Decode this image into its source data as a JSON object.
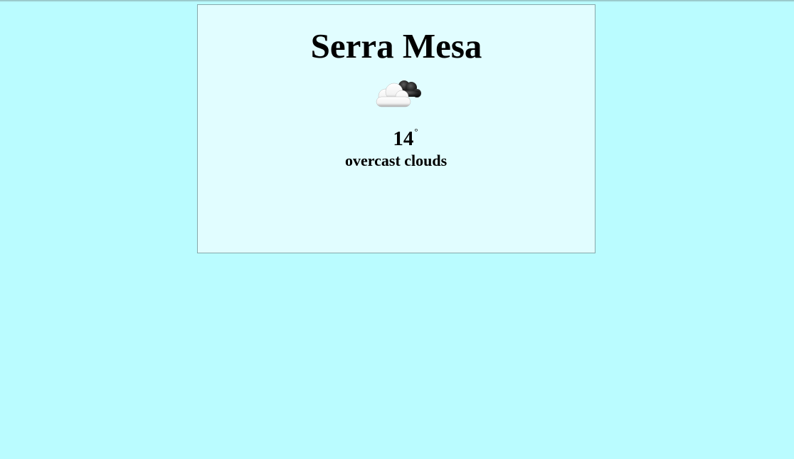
{
  "weather": {
    "city": "Serra Mesa",
    "temperature": "14",
    "degree_symbol": "°",
    "description": "overcast clouds",
    "icon": "overcast-clouds-icon"
  },
  "colors": {
    "page_background": "#bafcff",
    "card_background": "#e1fdff",
    "card_border": "#87a8aa",
    "text": "#000000"
  }
}
